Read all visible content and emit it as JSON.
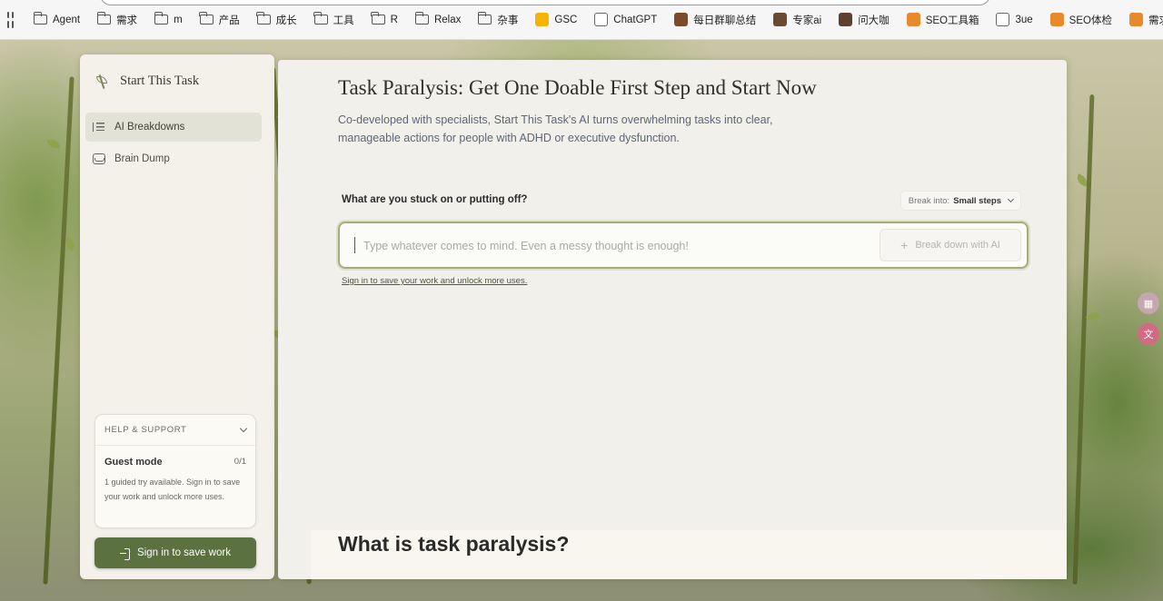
{
  "bookmarks": {
    "items": [
      {
        "label": "Agent",
        "type": "folder"
      },
      {
        "label": "需求",
        "type": "folder"
      },
      {
        "label": "m",
        "type": "folder"
      },
      {
        "label": "产品",
        "type": "folder"
      },
      {
        "label": "成长",
        "type": "folder"
      },
      {
        "label": "工具",
        "type": "folder"
      },
      {
        "label": "R",
        "type": "folder"
      },
      {
        "label": "Relax",
        "type": "folder"
      },
      {
        "label": "杂事",
        "type": "folder"
      },
      {
        "label": "GSC",
        "type": "site",
        "icon": "search-console-icon",
        "color": "#f4b400"
      },
      {
        "label": "ChatGPT",
        "type": "site",
        "icon": "chatgpt-icon",
        "color": "#ffffff"
      },
      {
        "label": "每日群聊总结",
        "type": "site",
        "icon": "avatar-icon",
        "color": "#7a4a2a"
      },
      {
        "label": "专家ai",
        "type": "site",
        "icon": "avatar-icon",
        "color": "#6b4a34"
      },
      {
        "label": "问大咖",
        "type": "site",
        "icon": "avatar-icon",
        "color": "#5d4030"
      },
      {
        "label": "SEO工具箱",
        "type": "site",
        "icon": "magnifier-icon",
        "color": "#e8892b"
      },
      {
        "label": "3ue",
        "type": "site",
        "icon": "cube-icon",
        "color": "#ffffff"
      },
      {
        "label": "SEO体检",
        "type": "site",
        "icon": "magnifier-icon",
        "color": "#e8892b"
      },
      {
        "label": "需求翻译器",
        "type": "site",
        "icon": "magnifier-icon",
        "color": "#e8892b"
      }
    ],
    "more_label": "»"
  },
  "sidebar": {
    "brand": "Start This Task",
    "nav": [
      {
        "label": "AI Breakdowns",
        "icon": "list-icon",
        "active": true
      },
      {
        "label": "Brain Dump",
        "icon": "inbox-icon",
        "active": false
      }
    ],
    "support": {
      "title": "HELP & SUPPORT",
      "guest_title": "Guest mode",
      "guest_count": "0/1",
      "guest_desc": "1 guided try available. Sign in to save your work and unlock more uses."
    },
    "signin_button": "Sign in to save work"
  },
  "main": {
    "title": "Task Paralysis: Get One Doable First Step and Start Now",
    "subtitle": "Co-developed with specialists, Start This Task's AI turns overwhelming tasks into clear, manageable actions for people with ADHD or executive dysfunction.",
    "prompt_label": "What are you stuck on or putting off?",
    "break_into_label": "Break into:",
    "break_into_value": "Small steps",
    "input_placeholder": "Type whatever comes to mind. Even a messy thought is enough!",
    "break_button": "Break down with AI",
    "signin_link": "Sign in to save your work and unlock more uses.",
    "section_title": "What is task paralysis?"
  },
  "colors": {
    "accent": "#5c7140",
    "paper": "#f2f0eb",
    "input_border": "#a6ab7c"
  }
}
